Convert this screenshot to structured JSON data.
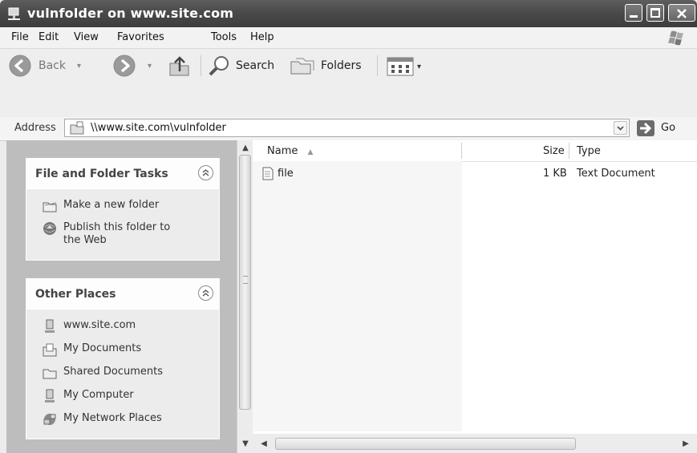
{
  "window": {
    "title": "vulnfolder on www.site.com",
    "icons": [
      "network-folder-icon",
      "minimize-icon",
      "maximize-icon",
      "close-icon"
    ]
  },
  "menu": {
    "items": [
      "File",
      "Edit",
      "View",
      "Favorites",
      "Tools",
      "Help"
    ]
  },
  "toolbar": {
    "back_label": "Back",
    "search_label": "Search",
    "folders_label": "Folders",
    "icons": [
      "back-arrow-icon",
      "forward-arrow-icon",
      "up-folder-icon",
      "search-magnifier-icon",
      "folders-icon",
      "views-icon"
    ]
  },
  "address": {
    "label": "Address",
    "value": "\\\\www.site.com\\vulnfolder",
    "go_label": "Go"
  },
  "tasks_panel": {
    "title": "File and Folder Tasks",
    "items": [
      {
        "label_line1": "Make a new folder",
        "label_line2": "",
        "icon": "new-folder-icon"
      },
      {
        "label_line1": "Publish this folder to",
        "label_line2": "the Web",
        "icon": "publish-web-icon"
      }
    ]
  },
  "places_panel": {
    "title": "Other Places",
    "items": [
      {
        "label": "www.site.com",
        "icon": "network-server-icon"
      },
      {
        "label": "My Documents",
        "icon": "my-documents-icon"
      },
      {
        "label": "Shared Documents",
        "icon": "shared-documents-icon"
      },
      {
        "label": "My Computer",
        "icon": "my-computer-icon"
      },
      {
        "label": "My Network Places",
        "icon": "network-places-icon"
      }
    ]
  },
  "list": {
    "columns": {
      "name": "Name",
      "size": "Size",
      "type": "Type"
    },
    "rows": [
      {
        "name": "file",
        "size": "1 KB",
        "type": "Text Document",
        "icon": "text-file-icon"
      }
    ]
  }
}
